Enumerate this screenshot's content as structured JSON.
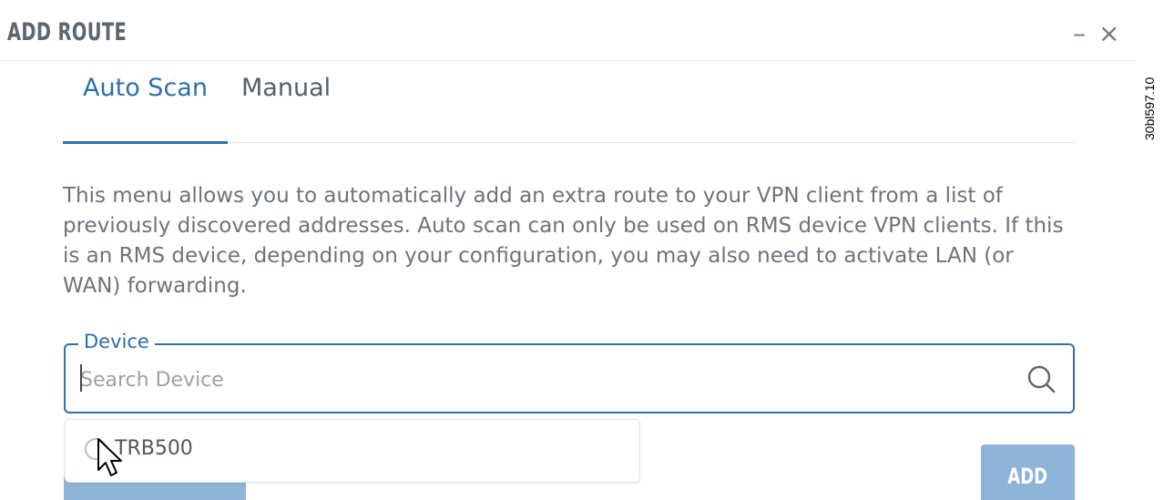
{
  "dialog": {
    "title": "ADD ROUTE",
    "minimize_label": "–",
    "close_label": "×"
  },
  "side_code": "30bl597.10",
  "tabs": [
    {
      "label": "Auto Scan",
      "active": true
    },
    {
      "label": "Manual",
      "active": false
    }
  ],
  "description": "This menu allows you to automatically add an extra route to your VPN client from a list of previously discovered addresses. Auto scan can only be used on RMS device VPN clients. If this is an RMS device, depending on your configuration, you may also need to activate LAN (or WAN) forwarding.",
  "device_field": {
    "legend": "Device",
    "value": "",
    "placeholder": "Search Device",
    "icon": "search-icon"
  },
  "dropdown": {
    "options": [
      {
        "label": "TRB500",
        "icon": "radio-icon"
      }
    ]
  },
  "buttons": {
    "add_label": "ADD"
  },
  "colors": {
    "accent": "#2f6ea8",
    "button": "#8cb3d8",
    "title": "#5c6670"
  }
}
